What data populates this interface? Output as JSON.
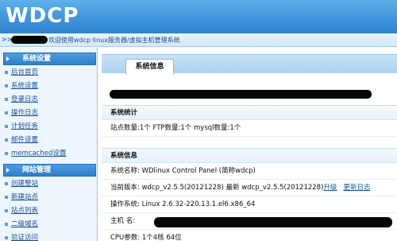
{
  "header": {
    "logo": "WDCP"
  },
  "topbar": {
    "arrows": ">>",
    "welcome": "欢迎使用wdcp linux服务器/虚拟主机管理系统"
  },
  "sidebar": {
    "groups": [
      {
        "title": "系统设置",
        "items": [
          "后台首页",
          "系统设置",
          "登录日志",
          "操作日志",
          "计划任务",
          "邮件设置",
          "memcached设置"
        ]
      },
      {
        "title": "网站管理",
        "items": [
          "创建整站",
          "新建站点",
          "站点列表",
          "二级域名",
          "验证访问"
        ]
      }
    ]
  },
  "main": {
    "tab_label": "系统信息",
    "stats": {
      "title": "系统统计",
      "line": "站点数量:1个  FTP数量:1个  mysql数量:1个"
    },
    "info": {
      "title": "系统信息",
      "system_name": "系统名称: WDlinux Control Panel (简称wdcp)",
      "version_current": "当前版本: wdcp_v2.5.5(20121228) 最新 wdcp_v2.5.5(20121228)",
      "upgrade_link": "升级",
      "changelog_link": "更新日志",
      "os": "操作系统: Linux 2.6.32-220.13.1.el6.x86_64",
      "host_label": "主机 名:",
      "cpu": "CPU参数: 1个4核 64位"
    }
  }
}
